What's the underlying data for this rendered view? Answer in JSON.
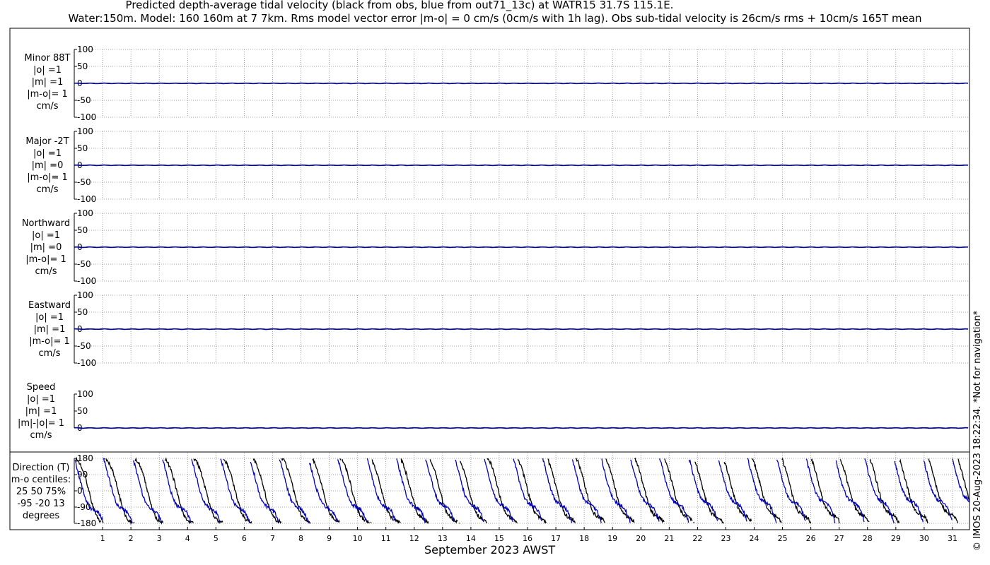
{
  "header": {
    "title_line1": "Predicted depth-average tidal velocity (black from obs, blue from out71_13c) at WATR15 31.7S 115.1E.",
    "title_line2": "Water:150m. Model: 160 160m at 7 7km. Rms model vector error |m-o| = 0 cm/s (0cm/s with 1h lag). Obs sub-tidal velocity is 26cm/s rms + 10cm/s 165T mean"
  },
  "footer": "© IMOS 20-Aug-2023 18:22:34. *Not for navigation*",
  "colors": {
    "obs": "#000000",
    "model": "#0000bb",
    "grid": "#888888"
  },
  "chart_data": {
    "type": "line",
    "xlabel": "September 2023 AWST",
    "x_ticks": [
      "1",
      "2",
      "3",
      "4",
      "5",
      "6",
      "7",
      "8",
      "9",
      "10",
      "11",
      "12",
      "13",
      "14",
      "15",
      "16",
      "17",
      "18",
      "19",
      "20",
      "21",
      "22",
      "23",
      "24",
      "25",
      "26",
      "27",
      "28",
      "29",
      "30",
      "31"
    ],
    "xlim": [
      0,
      31.6
    ],
    "panels": [
      {
        "label_lines": [
          "Minor 88T",
          "|o| =1",
          "|m| =1",
          "|m-o|= 1",
          "cm/s"
        ],
        "ylim": [
          -100,
          100
        ],
        "yticks": [
          "100",
          "50",
          "0",
          "-50",
          "-100"
        ],
        "grid": true,
        "series": [
          {
            "source": "obs",
            "level": 0
          },
          {
            "source": "model",
            "level": 0
          }
        ]
      },
      {
        "label_lines": [
          "Major -2T",
          "|o| =1",
          "|m| =0",
          "|m-o|= 1",
          "cm/s"
        ],
        "ylim": [
          -100,
          100
        ],
        "yticks": [
          "100",
          "50",
          "0",
          "-50",
          "-100"
        ],
        "grid": true,
        "series": [
          {
            "source": "obs",
            "level": 0
          },
          {
            "source": "model",
            "level": 0
          }
        ]
      },
      {
        "label_lines": [
          "Northward",
          "|o| =1",
          "|m| =0",
          "|m-o|= 1",
          "cm/s"
        ],
        "ylim": [
          -100,
          100
        ],
        "yticks": [
          "100",
          "50",
          "0",
          "-50",
          "-100"
        ],
        "grid": true,
        "series": [
          {
            "source": "obs",
            "level": 0
          },
          {
            "source": "model",
            "level": 0
          }
        ]
      },
      {
        "label_lines": [
          "Eastward",
          "|o| =1",
          "|m| =1",
          "|m-o|= 1",
          "cm/s"
        ],
        "ylim": [
          -100,
          100
        ],
        "yticks": [
          "100",
          "50",
          "0",
          "-50",
          "-100"
        ],
        "grid": true,
        "series": [
          {
            "source": "obs",
            "level": 0
          },
          {
            "source": "model",
            "level": 0
          }
        ]
      },
      {
        "label_lines": [
          "Speed",
          "|o| =1",
          "|m| =1",
          "|m|-|o|= 1",
          "cm/s"
        ],
        "ylim": [
          0,
          100
        ],
        "yticks": [
          "100",
          "50",
          "0"
        ],
        "grid": false,
        "series": [
          {
            "source": "obs",
            "level": 0
          },
          {
            "source": "model",
            "level": 0
          }
        ]
      },
      {
        "label_lines": [
          "Direction (T)",
          "m-o centiles:",
          "25  50  75%",
          "-95  -20  13",
          "degrees"
        ],
        "ylim": [
          -180,
          180
        ],
        "yticks": [
          "180",
          "90",
          "0",
          "-90",
          "-180"
        ],
        "grid": true,
        "series": [
          {
            "source": "obs",
            "name": "obs direction"
          },
          {
            "source": "model",
            "name": "model direction"
          }
        ]
      }
    ]
  }
}
